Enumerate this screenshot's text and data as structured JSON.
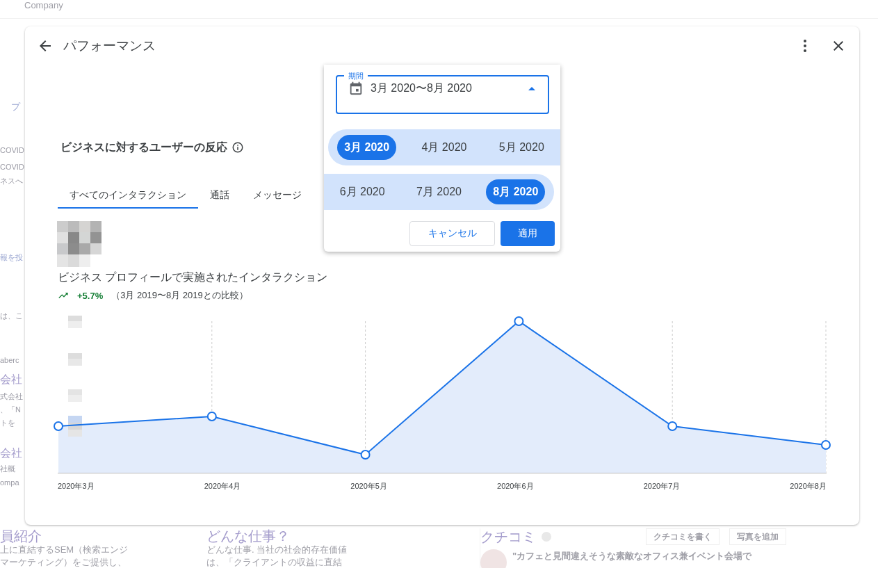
{
  "background": {
    "search_text": "Company",
    "left_strip": [
      "プ",
      "COVID",
      "COVID",
      "ネスへ",
      "報を投",
      "は、こ",
      "aberc",
      "会社",
      "式会社",
      "、「N",
      "トを",
      "会社",
      "社概",
      "ompa"
    ],
    "sections": [
      {
        "title": "員紹介",
        "lines": [
          "上に直結するSEM（検索エンジ",
          "マーケティング）をご提供し、"
        ]
      },
      {
        "title": "どんな仕事？",
        "lines": [
          "どんな仕事. 当社の社会的存在価値",
          "は、「クライアントの収益に直結"
        ]
      }
    ],
    "reviews": {
      "title": "クチコミ",
      "buttons": [
        "クチコミを書く",
        "写真を追加"
      ],
      "quote": "\"カフェと見間違えそうな素敵なオフィス兼イベント会場で"
    }
  },
  "dialog": {
    "title": "パフォーマンス",
    "section_title": "ビジネスに対するユーザーの反応",
    "tabs": [
      {
        "label": "すべてのインタラクション",
        "selected": true
      },
      {
        "label": "通話",
        "selected": false
      },
      {
        "label": "メッセージ",
        "selected": false
      }
    ],
    "chart_title": "ビジネス プロフィールで実施されたインタラクション",
    "change": "+5.7%",
    "comparison": "（3月 2019〜8月 2019との比較）",
    "x_labels": [
      "2020年3月",
      "2020年4月",
      "2020年5月",
      "2020年6月",
      "2020年7月",
      "2020年8月"
    ]
  },
  "date_picker": {
    "label": "期間",
    "value": "3月 2020〜8月 2020",
    "months": [
      {
        "label": "3月 2020",
        "selected": true,
        "in_range": true
      },
      {
        "label": "4月 2020",
        "selected": false,
        "in_range": true
      },
      {
        "label": "5月 2020",
        "selected": false,
        "in_range": true
      },
      {
        "label": "6月 2020",
        "selected": false,
        "in_range": true
      },
      {
        "label": "7月 2020",
        "selected": false,
        "in_range": true
      },
      {
        "label": "8月 2020",
        "selected": true,
        "in_range": true
      }
    ],
    "cancel": "キャンセル",
    "apply": "適用"
  }
}
